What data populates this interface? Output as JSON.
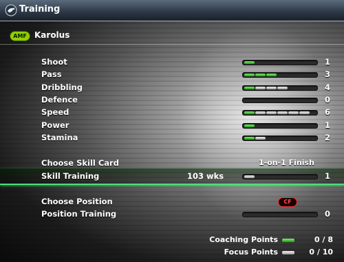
{
  "window": {
    "title": "Training",
    "icon": "whistle-icon"
  },
  "player": {
    "position": "AMF",
    "name": "Karolus"
  },
  "stats": [
    {
      "label": "Shoot",
      "value": "1",
      "green": 1,
      "grey": 0
    },
    {
      "label": "Pass",
      "value": "3",
      "green": 3,
      "grey": 0
    },
    {
      "label": "Dribbling",
      "value": "4",
      "green": 1,
      "grey": 3
    },
    {
      "label": "Defence",
      "value": "0",
      "green": 0,
      "grey": 0
    },
    {
      "label": "Speed",
      "value": "6",
      "green": 1,
      "grey": 5
    },
    {
      "label": "Power",
      "value": "1",
      "green": 1,
      "grey": 0
    },
    {
      "label": "Stamina",
      "value": "2",
      "green": 1,
      "grey": 1
    }
  ],
  "skill": {
    "choose_label": "Choose Skill Card",
    "card_name": "1-on-1 Finish",
    "training_label": "Skill Training",
    "weeks": "103 wks",
    "training_value": "1",
    "green": 0,
    "grey": 1
  },
  "position": {
    "choose_label": "Choose Position",
    "selected": "CF",
    "training_label": "Position Training",
    "training_value": "0",
    "green": 0,
    "grey": 0
  },
  "points": {
    "coaching_label": "Coaching Points",
    "coaching_value": "0 /   8",
    "focus_label": "Focus Points",
    "focus_value": "0 /  10"
  },
  "colors": {
    "accent_green": "#4ee07c",
    "badge_green": "#8fd000",
    "badge_red": "#ff3030"
  }
}
